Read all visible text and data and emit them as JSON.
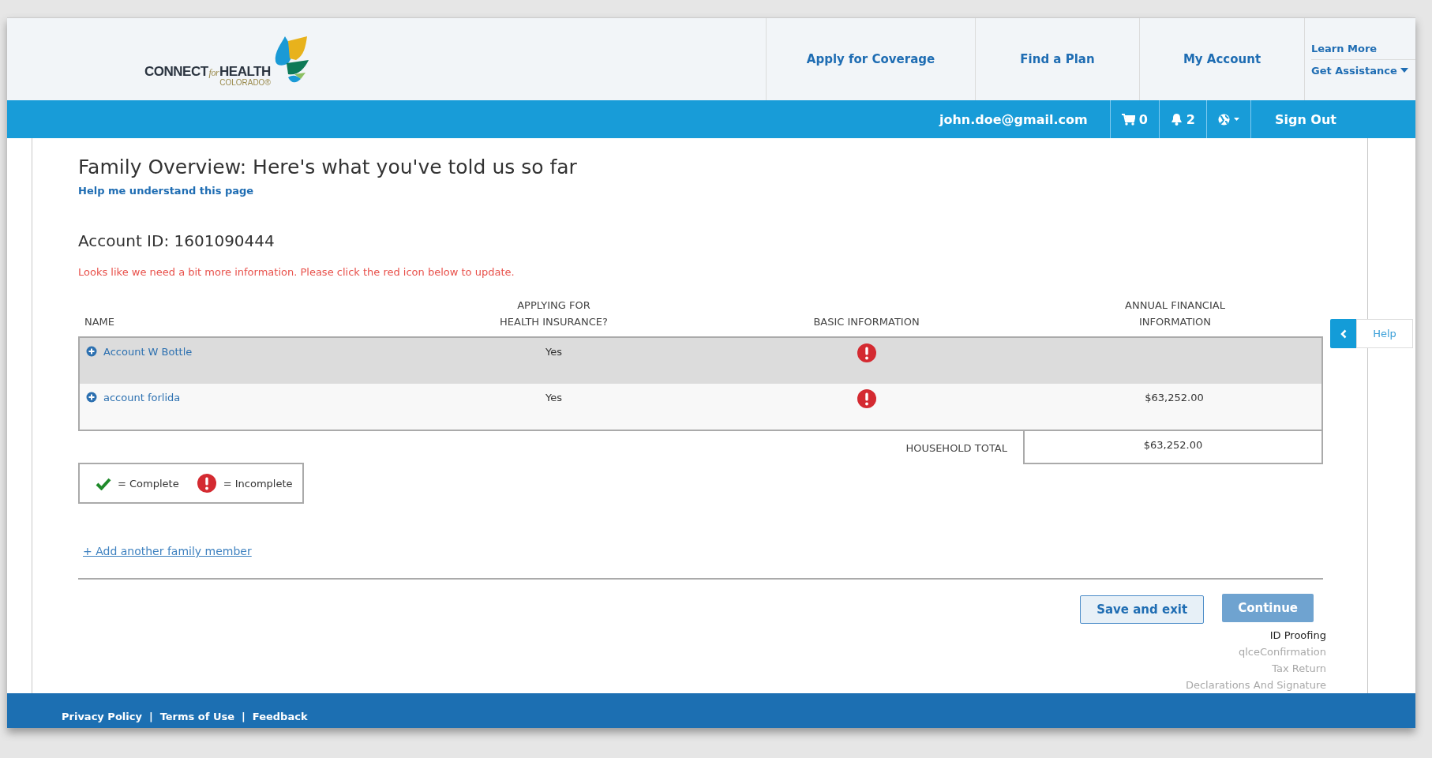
{
  "header": {
    "logo": {
      "word_1": "CONNECT",
      "word_2": "for",
      "word_3": "HEALTH",
      "subtitle": "COLORADO®"
    },
    "nav": [
      "Apply for Coverage",
      "Find a Plan",
      "My Account"
    ],
    "side_links": [
      {
        "label": "Learn More",
        "dropdown": false
      },
      {
        "label": "Get Assistance",
        "dropdown": true
      }
    ]
  },
  "user_bar": {
    "email": "john.doe@gmail.com",
    "cart_count": "0",
    "notification_count": "2",
    "sign_out": "Sign Out"
  },
  "page": {
    "title": "Family Overview: Here's what you've told us so far",
    "help_link": "Help me understand this page",
    "account_id": "Account ID: 1601090444",
    "alert": "Looks like we need a bit more information. Please click the red icon below to update."
  },
  "table": {
    "columns": [
      "NAME",
      "APPLYING FOR\nHEALTH INSURANCE?",
      "BASIC INFORMATION",
      "ANNUAL FINANCIAL\nINFORMATION"
    ],
    "rows": [
      {
        "name": "Account W Bottle",
        "applying": "Yes",
        "basic_complete": false,
        "annual": "",
        "highlighted": true
      },
      {
        "name": "account forlida",
        "applying": "Yes",
        "basic_complete": false,
        "annual": "$63,252.00",
        "highlighted": false
      }
    ],
    "total_label": "HOUSEHOLD TOTAL",
    "total_value": "$63,252.00"
  },
  "legend": [
    {
      "kind": "complete",
      "label": "= Complete"
    },
    {
      "kind": "incomplete",
      "label": "= Incomplete"
    }
  ],
  "add_link": "+ Add another family member",
  "buttons": [
    {
      "label": "Save and exit",
      "kind": "secondary",
      "disabled": false
    },
    {
      "label": "Continue",
      "kind": "primary",
      "disabled": true
    }
  ],
  "steps": [
    {
      "label": "ID Proofing",
      "current": true
    },
    {
      "label": "qlceConfirmation",
      "current": false
    },
    {
      "label": "Tax Return",
      "current": false
    },
    {
      "label": "Declarations And Signature",
      "current": false
    }
  ],
  "help_tab": "Help",
  "footer": {
    "links": [
      "Privacy Policy",
      "Terms of Use",
      "Feedback"
    ],
    "separator": "|"
  }
}
